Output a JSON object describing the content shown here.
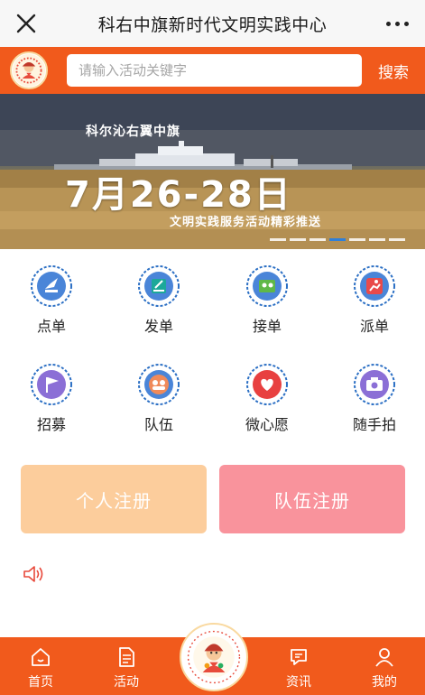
{
  "window": {
    "title": "科右中旗新时代文明实践中心",
    "close_icon": "close-icon",
    "more_icon": "more-icon"
  },
  "search": {
    "placeholder": "请输入活动关键字",
    "button_label": "搜索"
  },
  "banner": {
    "line1": "科尔沁右翼中旗",
    "date": "7月26-28日",
    "subtitle": "文明实践服务活动精彩推送",
    "slide_count": 7,
    "active_slide": 4
  },
  "grid": {
    "items": [
      {
        "label": "点单",
        "icon": "order-icon"
      },
      {
        "label": "发单",
        "icon": "publish-icon"
      },
      {
        "label": "接单",
        "icon": "accept-icon"
      },
      {
        "label": "派单",
        "icon": "dispatch-icon"
      },
      {
        "label": "招募",
        "icon": "recruit-flag-icon"
      },
      {
        "label": "队伍",
        "icon": "team-icon"
      },
      {
        "label": "微心愿",
        "icon": "heart-icon"
      },
      {
        "label": "随手拍",
        "icon": "camera-icon"
      }
    ]
  },
  "register": {
    "personal_label": "个人注册",
    "team_label": "队伍注册"
  },
  "section": {
    "partial_heading": "…"
  },
  "tabbar": {
    "items": [
      {
        "label": "首页",
        "icon": "home-icon"
      },
      {
        "label": "活动",
        "icon": "document-icon"
      },
      {
        "label": "资讯",
        "icon": "chat-icon"
      },
      {
        "label": "我的",
        "icon": "user-icon"
      }
    ]
  },
  "colors": {
    "accent": "#f15a1c",
    "personal_btn": "#fccd9c",
    "team_btn": "#f9939c",
    "icon_blue": "#2b6fc4",
    "icon_purple": "#8b6fd6",
    "active_dot": "#2f7fd8"
  }
}
